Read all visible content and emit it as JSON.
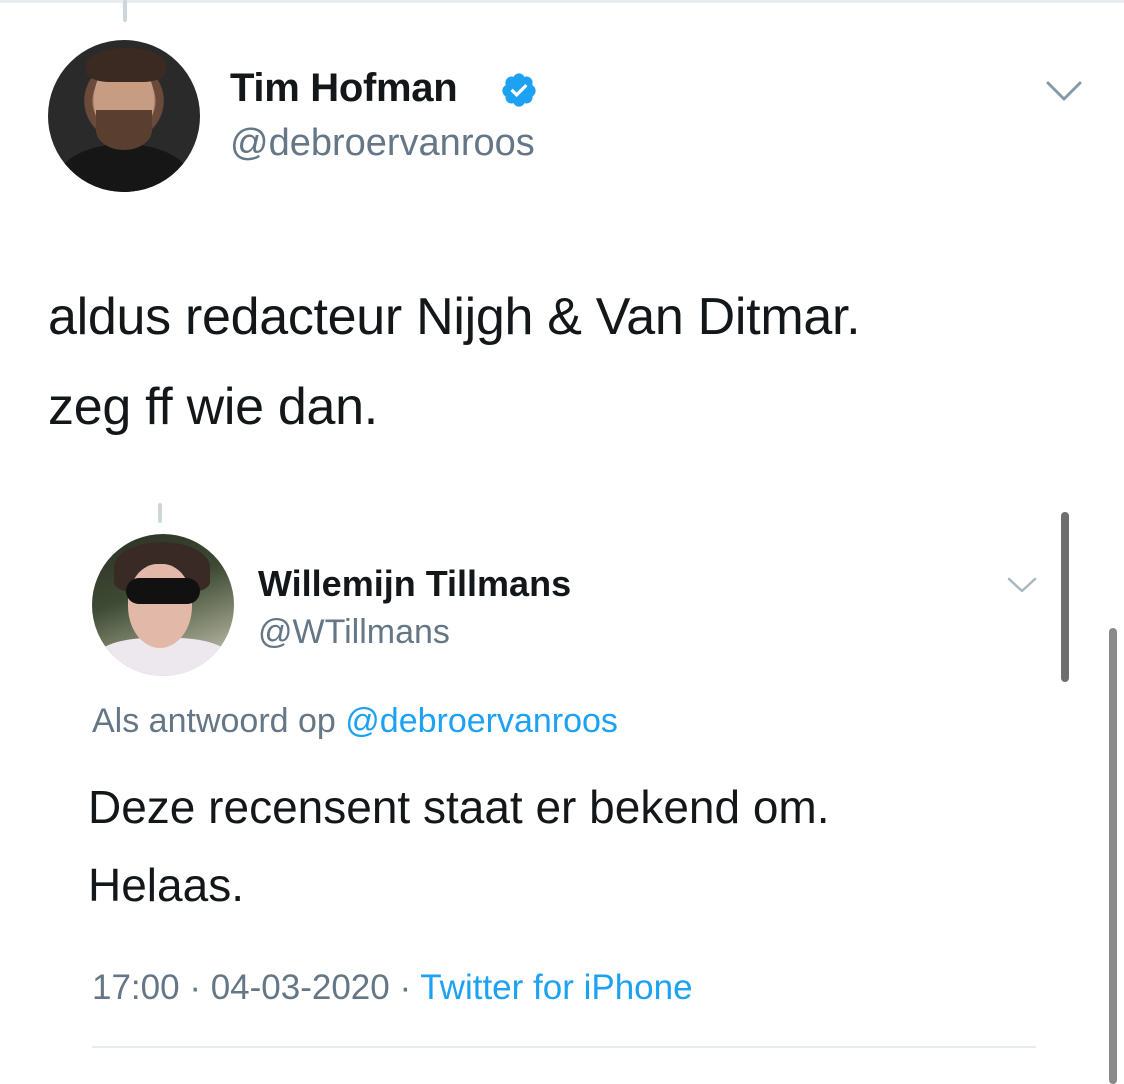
{
  "main_tweet": {
    "name": "Tim Hofman",
    "handle": "@debroervanroos",
    "verified": true,
    "text_line1": "aldus redacteur Nijgh & Van Ditmar.",
    "text_line2": "zeg ff wie dan."
  },
  "embedded_tweet": {
    "name": "Willemijn Tillmans",
    "handle": "@WTillmans",
    "reply_prefix": "Als antwoord op ",
    "reply_mention": "@debroervanroos",
    "text_line1": "Deze recensent staat er bekend om.",
    "text_line2": "Helaas.",
    "time": "17:00",
    "separator": " · ",
    "date": "04-03-2020",
    "source": "Twitter for iPhone"
  },
  "icons": {
    "verified": "verified-badge-icon",
    "menu": "chevron-down-icon"
  },
  "colors": {
    "link": "#1da1f2",
    "secondary_text": "#657786",
    "primary_text": "#14171a",
    "verified_badge": "#1da1f2"
  }
}
